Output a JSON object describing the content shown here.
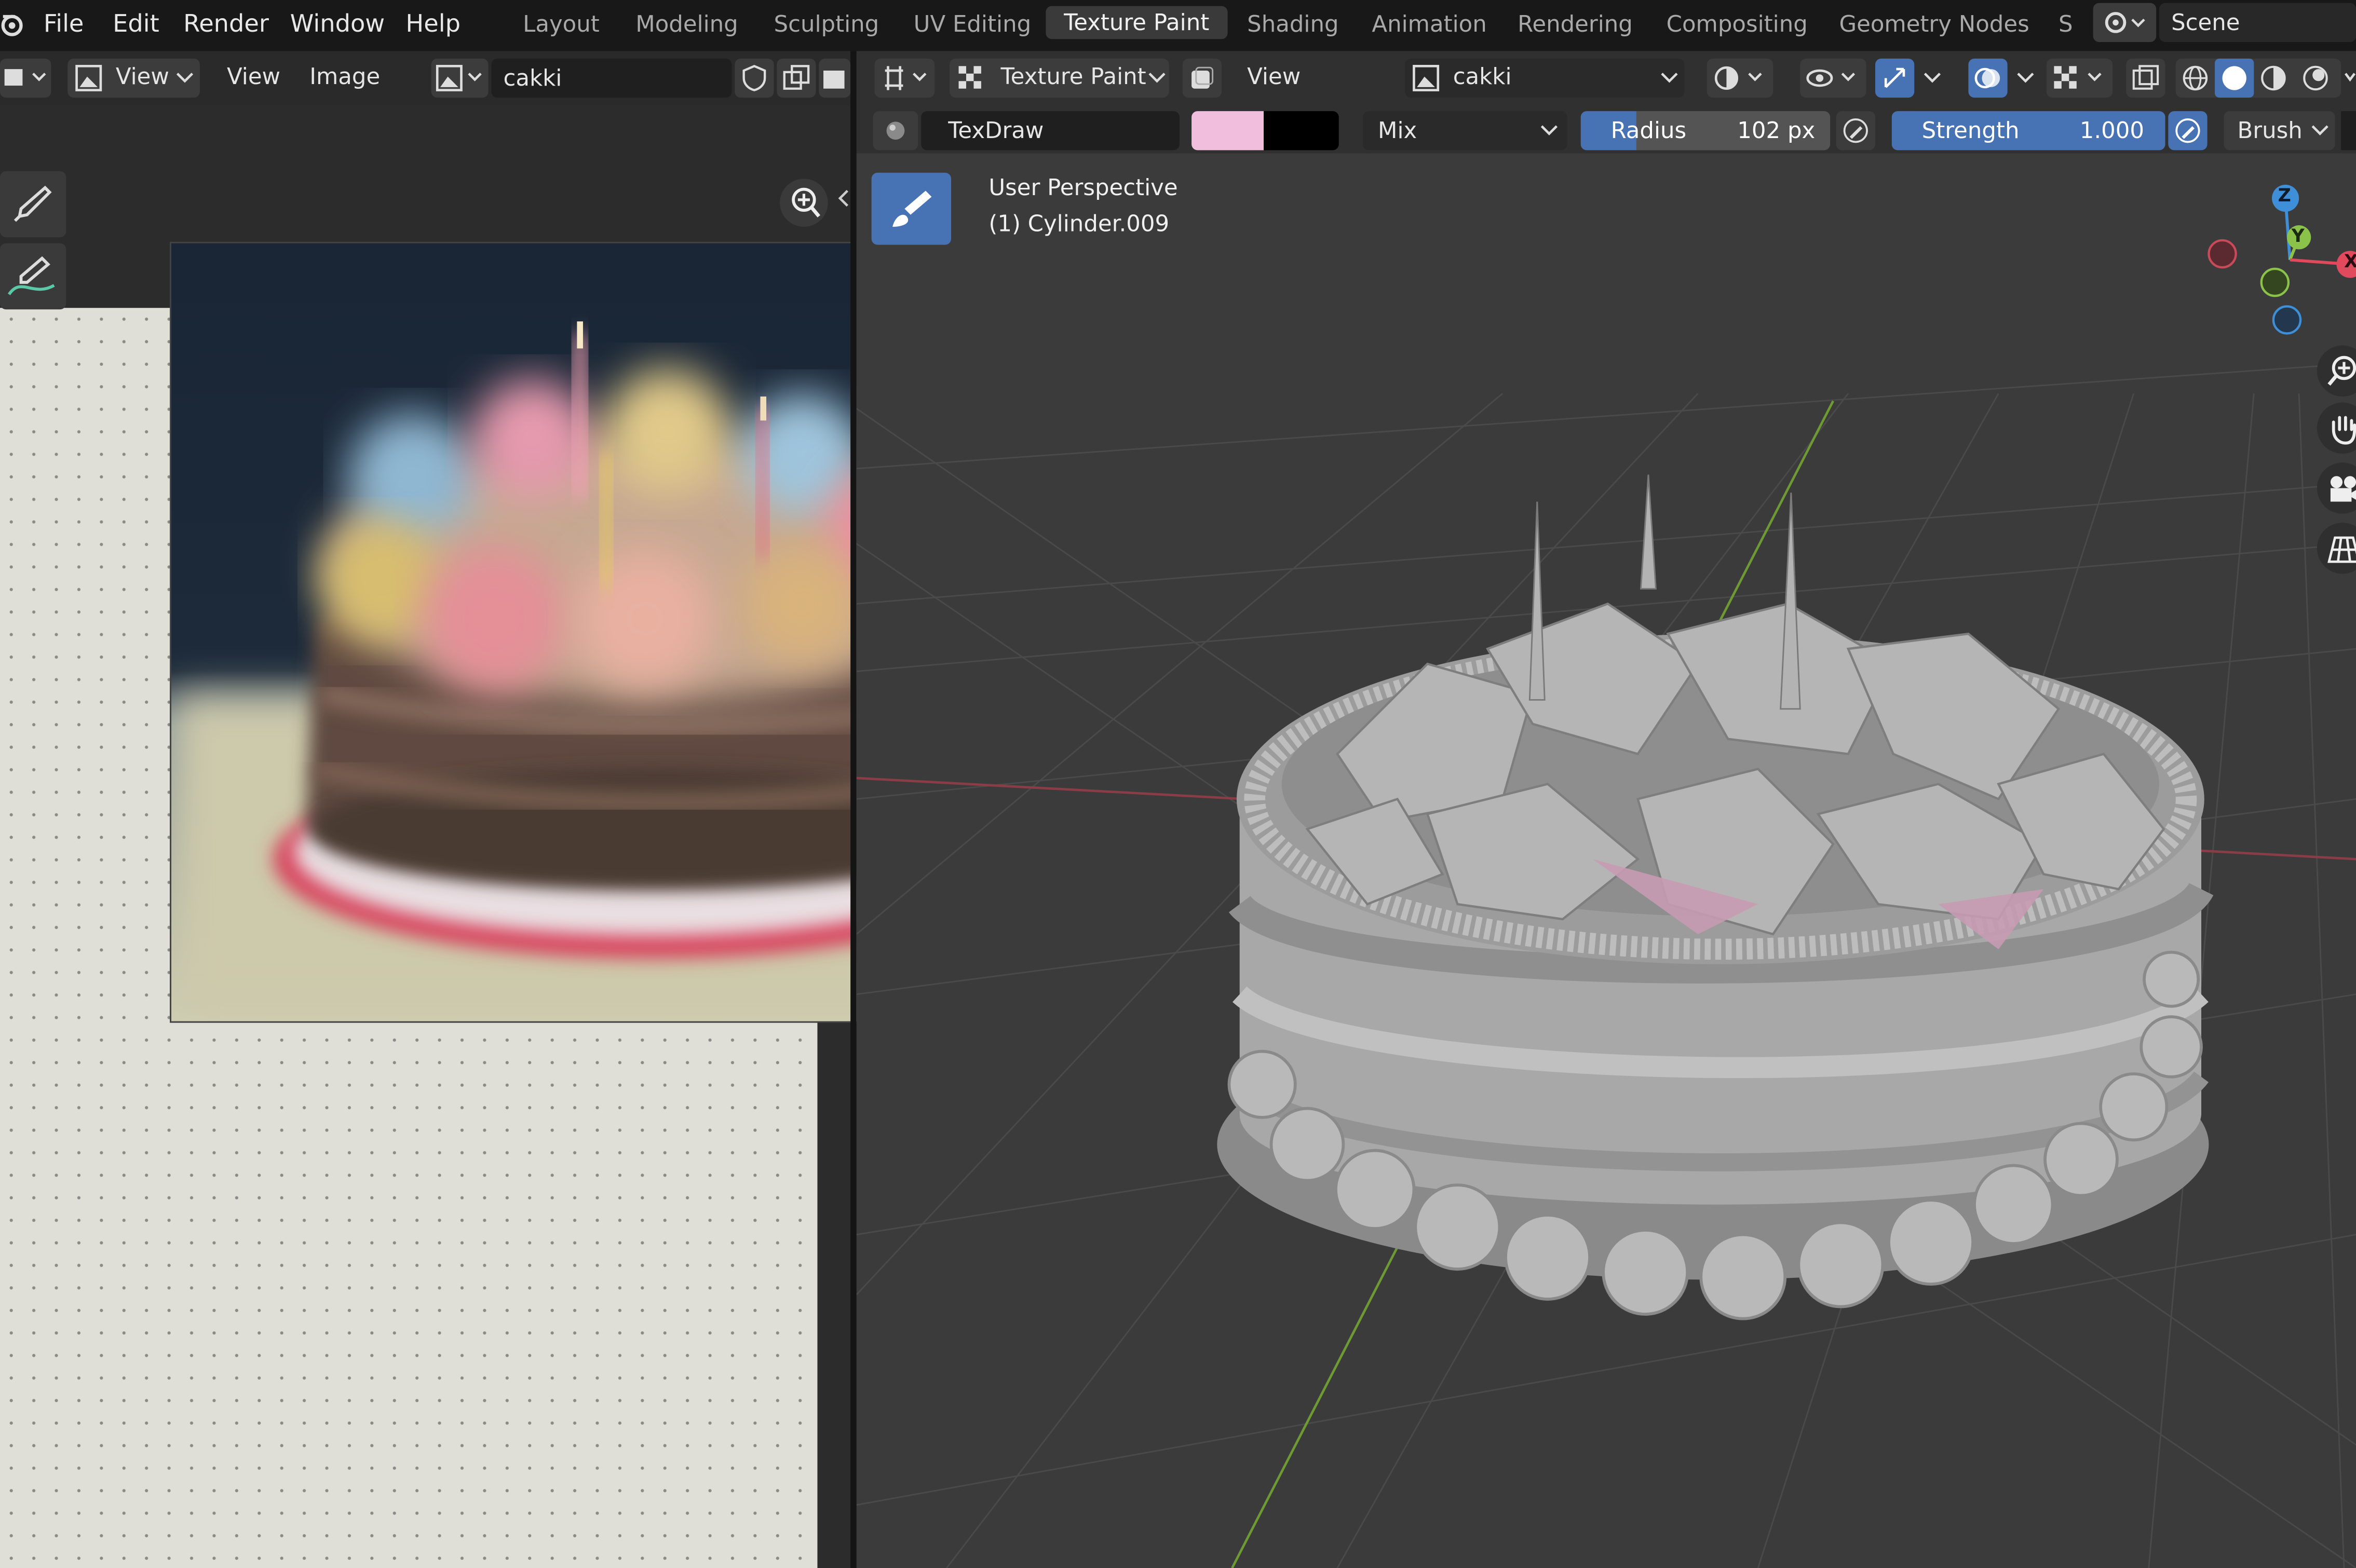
{
  "top_menu": {
    "items": [
      "File",
      "Edit",
      "Render",
      "Window",
      "Help"
    ]
  },
  "workspace_tabs": {
    "items": [
      "Layout",
      "Modeling",
      "Sculpting",
      "UV Editing",
      "Texture Paint",
      "Shading",
      "Animation",
      "Rendering",
      "Compositing",
      "Geometry Nodes",
      "S"
    ],
    "active": "Texture Paint"
  },
  "scene": {
    "label": "Scene"
  },
  "image_editor": {
    "view_menu": "View",
    "view2": "View",
    "image_menu": "Image",
    "image_name": "cakki"
  },
  "viewport_header": {
    "mode": "Texture Paint",
    "view_menu": "View",
    "texture_slot": "cakki"
  },
  "brush_settings": {
    "brush_name": "TexDraw",
    "primary_color": "#f2bedd",
    "secondary_color": "#000000",
    "blend_mode": "Mix",
    "radius_label": "Radius",
    "radius_value": "102 px",
    "strength_label": "Strength",
    "strength_value": "1.000",
    "brush_menu": "Brush"
  },
  "viewport_overlay": {
    "perspective": "User Perspective",
    "object": "(1) Cylinder.009"
  },
  "gizmo": {
    "z": "Z",
    "y": "Y",
    "x": "X"
  },
  "colors": {
    "accent_blue": "#4772b3",
    "axis_x": "#e04a5c",
    "axis_y": "#8bc34a",
    "axis_z": "#3f8fd8"
  }
}
